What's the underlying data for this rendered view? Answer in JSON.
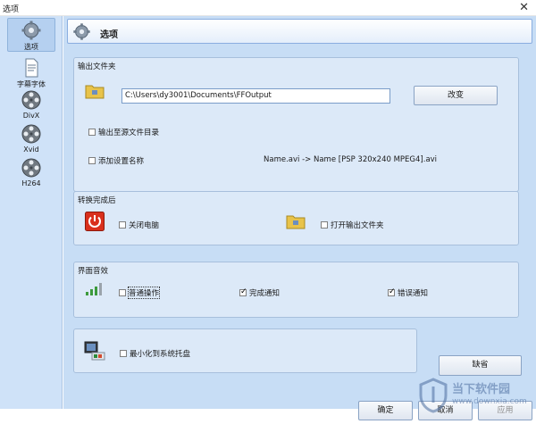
{
  "window": {
    "title": "选项",
    "close_glyph": "✕"
  },
  "sidebar": {
    "items": [
      {
        "label": "选项",
        "icon": "gear-icon",
        "selected": true
      },
      {
        "label": "字幕字体",
        "icon": "document-icon"
      },
      {
        "label": "DivX",
        "icon": "film-reel-icon"
      },
      {
        "label": "Xvid",
        "icon": "film-reel-icon"
      },
      {
        "label": "H264",
        "icon": "film-reel-icon"
      }
    ]
  },
  "header": {
    "title": "选项",
    "icon": "gear-icon"
  },
  "output_folder": {
    "legend": "输出文件夹",
    "path_value": "C:\\Users\\dy3001\\Documents\\FFOutput",
    "change_button": "改变",
    "output_to_source_label": "输出至源文件目录",
    "output_to_source_checked": false,
    "add_setting_name_label": "添加设置名称",
    "add_setting_name_checked": false,
    "name_example": "Name.avi  -> Name [PSP 320x240 MPEG4].avi"
  },
  "after_convert": {
    "legend": "转换完成后",
    "shutdown_label": "关闭电脑",
    "shutdown_checked": false,
    "open_folder_label": "打开输出文件夹",
    "open_folder_checked": false
  },
  "sound": {
    "legend": "界面音效",
    "normal_op_label": "普通操作",
    "normal_op_checked": false,
    "complete_label": "完成通知",
    "complete_checked": true,
    "error_label": "错误通知",
    "error_checked": true
  },
  "tray": {
    "minimize_label": "最小化到系统托盘",
    "minimize_checked": false
  },
  "buttons": {
    "default": "缺省",
    "ok": "确定",
    "cancel": "取消",
    "apply": "应用"
  },
  "watermark": {
    "text": "当下软件园",
    "sub": "www.downxia.com"
  },
  "colors": {
    "sidebar_bg": "#cfe2f8",
    "panel_bg": "#c7ddf5",
    "group_bg": "#dce9f8",
    "power_red": "#d9301c",
    "folder_yellow": "#e8c34a"
  }
}
